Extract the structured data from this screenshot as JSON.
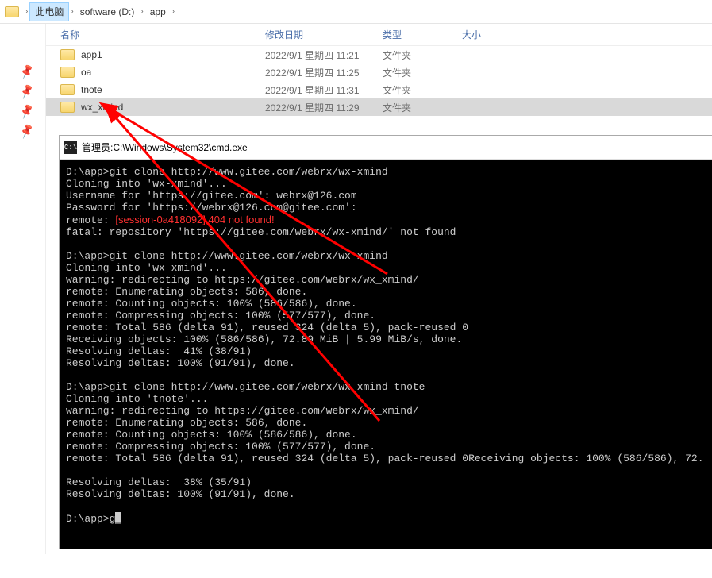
{
  "breadcrumb": {
    "this_pc": "此电脑",
    "drive": "software (D:)",
    "folder": "app"
  },
  "columns": {
    "name": "名称",
    "date": "修改日期",
    "type": "类型",
    "size": "大小"
  },
  "files": [
    {
      "name": "app1",
      "date": "2022/9/1 星期四 11:21",
      "type": "文件夹",
      "size": "",
      "selected": false
    },
    {
      "name": "oa",
      "date": "2022/9/1 星期四 11:25",
      "type": "文件夹",
      "size": "",
      "selected": false
    },
    {
      "name": "tnote",
      "date": "2022/9/1 星期四 11:31",
      "type": "文件夹",
      "size": "",
      "selected": false
    },
    {
      "name": "wx_xmind",
      "date": "2022/9/1 星期四 11:29",
      "type": "文件夹",
      "size": "",
      "selected": true
    }
  ],
  "terminal": {
    "title_prefix": "管理员: ",
    "title_path": "C:\\Windows\\System32\\cmd.exe",
    "lines": [
      {
        "t": "D:\\app>git clone http://www.gitee.com/webrx/wx-xmind"
      },
      {
        "t": "Cloning into 'wx-xmind'..."
      },
      {
        "t": "Username for 'https://gitee.com': webrx@126.com"
      },
      {
        "t": "Password for 'https://webrx@126.com@gitee.com':"
      },
      {
        "t": "remote: [session-0a418092] 404 not found!",
        "red_from": 8
      },
      {
        "t": "fatal: repository 'https://gitee.com/webrx/wx-xmind/' not found"
      },
      {
        "t": ""
      },
      {
        "t": "D:\\app>git clone http://www.gitee.com/webrx/wx_xmind"
      },
      {
        "t": "Cloning into 'wx_xmind'..."
      },
      {
        "t": "warning: redirecting to https://gitee.com/webrx/wx_xmind/"
      },
      {
        "t": "remote: Enumerating objects: 586, done."
      },
      {
        "t": "remote: Counting objects: 100% (586/586), done."
      },
      {
        "t": "remote: Compressing objects: 100% (577/577), done."
      },
      {
        "t": "remote: Total 586 (delta 91), reused 324 (delta 5), pack-reused 0"
      },
      {
        "t": "Receiving objects: 100% (586/586), 72.89 MiB | 5.99 MiB/s, done."
      },
      {
        "t": "Resolving deltas:  41% (38/91)"
      },
      {
        "t": "Resolving deltas: 100% (91/91), done."
      },
      {
        "t": ""
      },
      {
        "t": "D:\\app>git clone http://www.gitee.com/webrx/wx_xmind tnote"
      },
      {
        "t": "Cloning into 'tnote'..."
      },
      {
        "t": "warning: redirecting to https://gitee.com/webrx/wx_xmind/"
      },
      {
        "t": "remote: Enumerating objects: 586, done."
      },
      {
        "t": "remote: Counting objects: 100% (586/586), done."
      },
      {
        "t": "remote: Compressing objects: 100% (577/577), done."
      },
      {
        "t": "remote: Total 586 (delta 91), reused 324 (delta 5), pack-reused 0Receiving objects: 100% (586/586), 72."
      },
      {
        "t": ""
      },
      {
        "t": "Resolving deltas:  38% (35/91)"
      },
      {
        "t": "Resolving deltas: 100% (91/91), done."
      },
      {
        "t": ""
      },
      {
        "t": "D:\\app>g",
        "cursor": true
      }
    ]
  }
}
